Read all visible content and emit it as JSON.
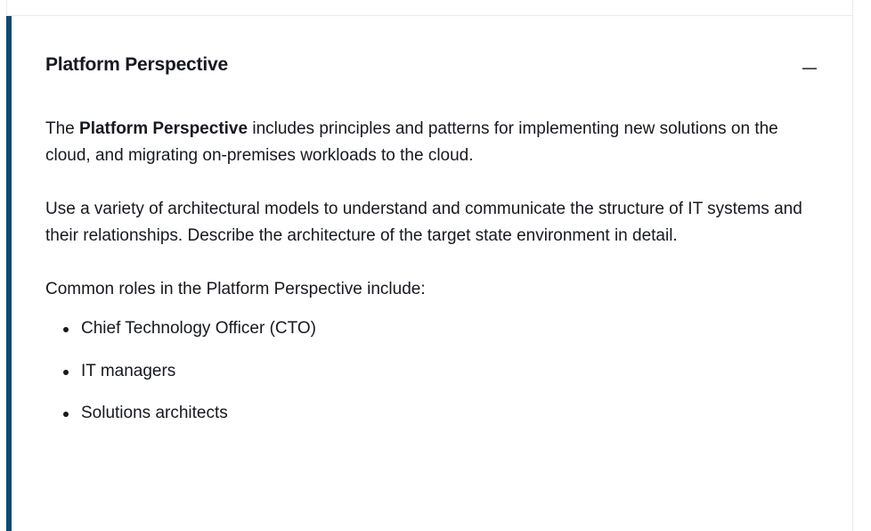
{
  "panel": {
    "title": "Platform Perspective",
    "collapse_icon": "minus-icon",
    "accent_color": "#0a4a74"
  },
  "body": {
    "para1": {
      "prefix": "The ",
      "bold": "Platform Perspective",
      "suffix": " includes principles and patterns for implementing new solutions on the cloud, and migrating on-premises workloads to the cloud."
    },
    "para2": "Use a variety of architectural models to understand and communicate the structure of IT systems and their relationships. Describe the architecture of the target state environment in detail.",
    "roles_intro": "Common roles in the Platform Perspective include:",
    "roles": [
      "Chief Technology Officer (CTO)",
      "IT managers",
      "Solutions architects"
    ]
  }
}
